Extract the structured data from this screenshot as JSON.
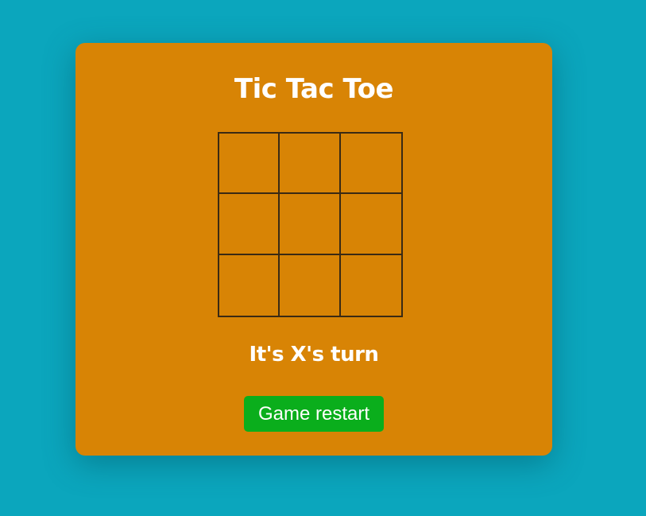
{
  "game": {
    "title": "Tic Tac Toe",
    "status": "It's X's turn",
    "restart_label": "Game restart",
    "board": [
      "",
      "",
      "",
      "",
      "",
      "",
      "",
      "",
      ""
    ]
  },
  "colors": {
    "background": "#0ba6bd",
    "card": "#d88405",
    "grid_lines": "#3a2a14",
    "text": "#ffffff",
    "restart_button": "#0aae1c"
  }
}
